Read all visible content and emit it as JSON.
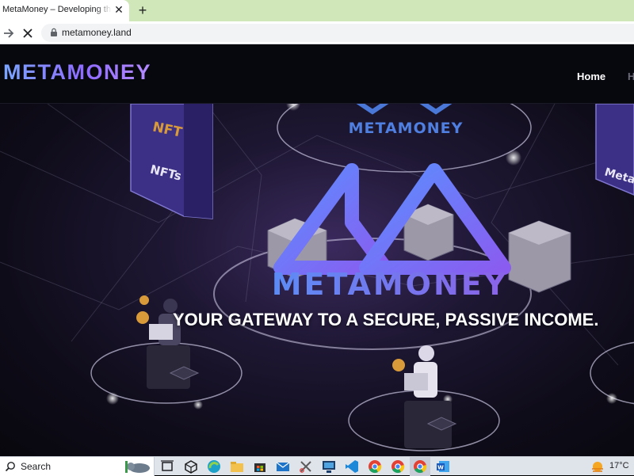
{
  "browser": {
    "tab_title": "MetaMoney – Developing the Metaverse",
    "tab_close_glyph": "✕",
    "new_tab_glyph": "+",
    "url": "metamoney.land"
  },
  "site": {
    "logo": "METAMONEY",
    "nav": {
      "home": "Home",
      "next_partial": "H"
    },
    "hero": {
      "brand_text": "METAMONEY",
      "top_badge": "METAMONEY",
      "card_nft_badge": "NFT",
      "card_nft_label": "NFTs",
      "card_right_label": "Meta",
      "tagline": "YOUR GATEWAY TO A SECURE, PASSIVE INCOME."
    }
  },
  "taskbar": {
    "search_label": "Search",
    "weather_temp": "17°C"
  },
  "colors": {
    "accent_blue": "#7aa6ff",
    "accent_purple": "#8f6bff",
    "tabstrip_bg": "#cfe7b9",
    "header_bg": "#07070e"
  }
}
